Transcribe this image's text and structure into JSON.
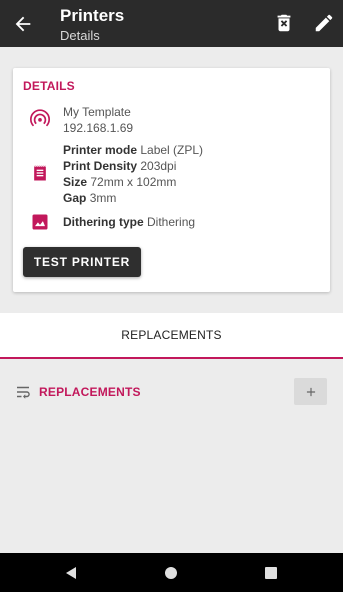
{
  "appbar": {
    "title": "Printers",
    "subtitle": "Details",
    "icons": {
      "back": "arrow-left-icon",
      "delete": "delete-icon",
      "edit": "pencil-icon"
    }
  },
  "details": {
    "heading": "DETAILS",
    "name": "My Template",
    "address": "192.168.1.69",
    "mode_label": "Printer mode",
    "mode_value": "Label (ZPL)",
    "density_label": "Print Density",
    "density_value": "203dpi",
    "size_label": "Size",
    "size_value": "72mm x 102mm",
    "gap_label": "Gap",
    "gap_value": "3mm",
    "dithering_label": "Dithering type",
    "dithering_value": "Dithering",
    "test_button": "TEST PRINTER",
    "icons": {
      "network": "network-icon",
      "label": "label-icon",
      "image": "image-icon"
    }
  },
  "tabs": {
    "active": "REPLACEMENTS"
  },
  "replacements": {
    "label": "REPLACEMENTS",
    "icons": {
      "wrap": "text-wrap-icon",
      "add": "plus-icon"
    }
  },
  "colors": {
    "accent": "#c2185b",
    "appbar": "#2b2b2b",
    "background": "#ececec"
  }
}
